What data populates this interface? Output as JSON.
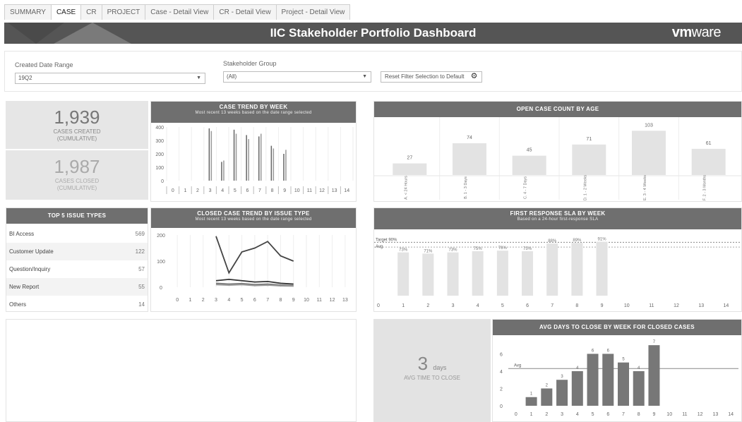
{
  "tabs": [
    "SUMMARY",
    "CASE",
    "CR",
    "PROJECT",
    "Case - Detail View",
    "CR - Detail View",
    "Project - Detail View"
  ],
  "active_tab": 1,
  "banner": {
    "title": "IIC Stakeholder Portfolio Dashboard",
    "logo_bold": "vm",
    "logo_thin": "ware"
  },
  "filters": {
    "date_label": "Created Date Range",
    "date_value": "19Q2",
    "group_label": "Stakeholder Group",
    "group_value": "(All)",
    "reset_label": "Reset Filter Selection to Default"
  },
  "kpis": {
    "created_value": "1,939",
    "created_label_1": "CASES CREATED",
    "created_label_2": "(CUMULATIVE)",
    "closed_value": "1,987",
    "closed_label_1": "CASES CLOSED",
    "closed_label_2": "(CUMULATIVE)"
  },
  "top_issues": {
    "title": "TOP 5 ISSUE TYPES",
    "rows": [
      {
        "name": "BI Access",
        "value": "569"
      },
      {
        "name": "Customer Update",
        "value": "122"
      },
      {
        "name": "Question/Inquiry",
        "value": "57"
      },
      {
        "name": "New Report",
        "value": "55"
      },
      {
        "name": "Others",
        "value": "14"
      }
    ]
  },
  "avg_close": {
    "value": "3",
    "unit": "days",
    "label": "AVG TIME TO CLOSE"
  },
  "chart_data": [
    {
      "id": "case_trend",
      "type": "bar",
      "title": "CASE TREND BY WEEK",
      "subtitle": "Most recent 13 weeks based on the date range selected",
      "categories": [
        "0",
        "1",
        "2",
        "3",
        "4",
        "5",
        "6",
        "7",
        "8",
        "9",
        "10",
        "11",
        "12",
        "13",
        "14"
      ],
      "series": [
        {
          "name": "Created",
          "values": [
            0,
            0,
            0,
            390,
            140,
            380,
            340,
            330,
            260,
            200,
            0,
            0,
            0,
            0,
            0
          ]
        },
        {
          "name": "Closed",
          "values": [
            0,
            0,
            0,
            370,
            150,
            350,
            310,
            350,
            240,
            230,
            0,
            0,
            0,
            0,
            0
          ]
        }
      ],
      "ylim": [
        0,
        400
      ],
      "yticks": [
        0,
        100,
        200,
        300,
        400
      ]
    },
    {
      "id": "open_by_age",
      "type": "bar",
      "title": "OPEN CASE COUNT BY AGE",
      "categories": [
        "A. < 24 Hours",
        "B. 1 - 3 Days",
        "C. 4 - 7 Days",
        "D. 1 - 2 Weeks",
        "E. 3 - 4 Weeks",
        "F. 2 - 3 Months"
      ],
      "values": [
        27,
        74,
        45,
        71,
        103,
        61
      ],
      "ylim": [
        0,
        115
      ]
    },
    {
      "id": "closed_by_issue",
      "type": "line",
      "title": "CLOSED CASE TREND BY ISSUE TYPE",
      "subtitle": "Most recent 13 weeks based on the date range selected",
      "x": [
        0,
        1,
        2,
        3,
        4,
        5,
        6,
        7,
        8,
        9,
        10,
        11,
        12,
        13
      ],
      "series": [
        {
          "name": "BI Access",
          "color": "#444444",
          "points": [
            [
              3,
              195
            ],
            [
              4,
              55
            ],
            [
              5,
              135
            ],
            [
              6,
              150
            ],
            [
              7,
              175
            ],
            [
              8,
              120
            ],
            [
              9,
              100
            ]
          ]
        },
        {
          "name": "Customer Update",
          "color": "#333333",
          "points": [
            [
              3,
              25
            ],
            [
              4,
              30
            ],
            [
              5,
              25
            ],
            [
              6,
              20
            ],
            [
              7,
              22
            ],
            [
              8,
              15
            ],
            [
              9,
              12
            ]
          ]
        },
        {
          "name": "Question/Inquiry",
          "color": "#777777",
          "points": [
            [
              3,
              15
            ],
            [
              4,
              12
            ],
            [
              5,
              14
            ],
            [
              6,
              10
            ],
            [
              7,
              12
            ],
            [
              8,
              8
            ],
            [
              9,
              6
            ]
          ]
        },
        {
          "name": "New Report",
          "color": "#999999",
          "points": [
            [
              3,
              10
            ],
            [
              4,
              8
            ],
            [
              5,
              10
            ],
            [
              6,
              6
            ],
            [
              7,
              8
            ],
            [
              8,
              5
            ],
            [
              9,
              4
            ]
          ]
        }
      ],
      "ylim": [
        0,
        200
      ],
      "yticks": [
        0,
        100,
        200
      ]
    },
    {
      "id": "first_response_sla",
      "type": "bar",
      "title": "FIRST RESPONSE SLA  BY WEEK",
      "subtitle": "Based on a 24-hour first-response SLA",
      "target_label": "Target 90%",
      "avg_label": "Avg",
      "categories": [
        "0",
        "1",
        "2",
        "3",
        "4",
        "5",
        "6",
        "7",
        "8",
        "9",
        "10",
        "11",
        "12",
        "13",
        "14"
      ],
      "values": [
        null,
        73,
        71,
        73,
        75,
        76,
        75,
        88,
        89,
        91,
        null,
        null,
        null,
        null,
        null
      ],
      "labels": [
        "",
        "73%",
        "71%",
        "73%",
        "75%",
        "76%",
        "75%",
        "88%",
        "89%",
        "91%",
        "",
        "",
        "",
        "",
        ""
      ],
      "target": 90,
      "ylim": [
        0,
        100
      ]
    },
    {
      "id": "avg_days_to_close",
      "type": "bar",
      "title": "AVG DAYS TO CLOSE BY WEEK FOR CLOSED CASES",
      "avg_label": "Avg",
      "categories": [
        "0",
        "1",
        "2",
        "3",
        "4",
        "5",
        "6",
        "7",
        "8",
        "9",
        "10",
        "11",
        "12",
        "13",
        "14"
      ],
      "values": [
        null,
        1,
        2,
        3,
        4,
        6,
        6,
        5,
        4,
        7,
        null,
        null,
        null,
        null,
        null
      ],
      "avg": 4.3,
      "ylim": [
        0,
        7.5
      ],
      "yticks": [
        0,
        2,
        4,
        6
      ]
    }
  ]
}
